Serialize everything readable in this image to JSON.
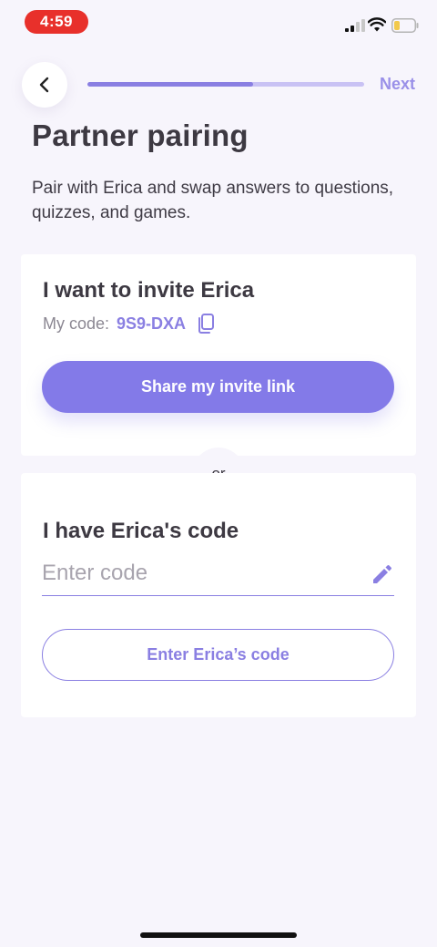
{
  "status_bar": {
    "time": "4:59"
  },
  "header": {
    "next_label": "Next",
    "progress": 0.6
  },
  "page": {
    "title": "Partner pairing",
    "subtitle": "Pair with Erica and swap answers to questions, quizzes, and games."
  },
  "invite_card": {
    "title": "I want to invite Erica",
    "code_label": "My code:",
    "code_value": "9S9-DXA",
    "share_button_label": "Share my invite link"
  },
  "divider": {
    "label": "or"
  },
  "code_card": {
    "title": "I have Erica's code",
    "input_value": "",
    "input_placeholder": "Enter code",
    "enter_button_label": "Enter Erica’s code"
  },
  "colors": {
    "accent": "#837ae8",
    "background": "#f7f5fc",
    "time_pill": "#e8302b"
  },
  "icons": {
    "back": "chevron-left-icon",
    "copy": "copy-icon",
    "edit": "pencil-icon",
    "signal": "signal-icon",
    "wifi": "wifi-icon",
    "battery": "battery-icon"
  }
}
